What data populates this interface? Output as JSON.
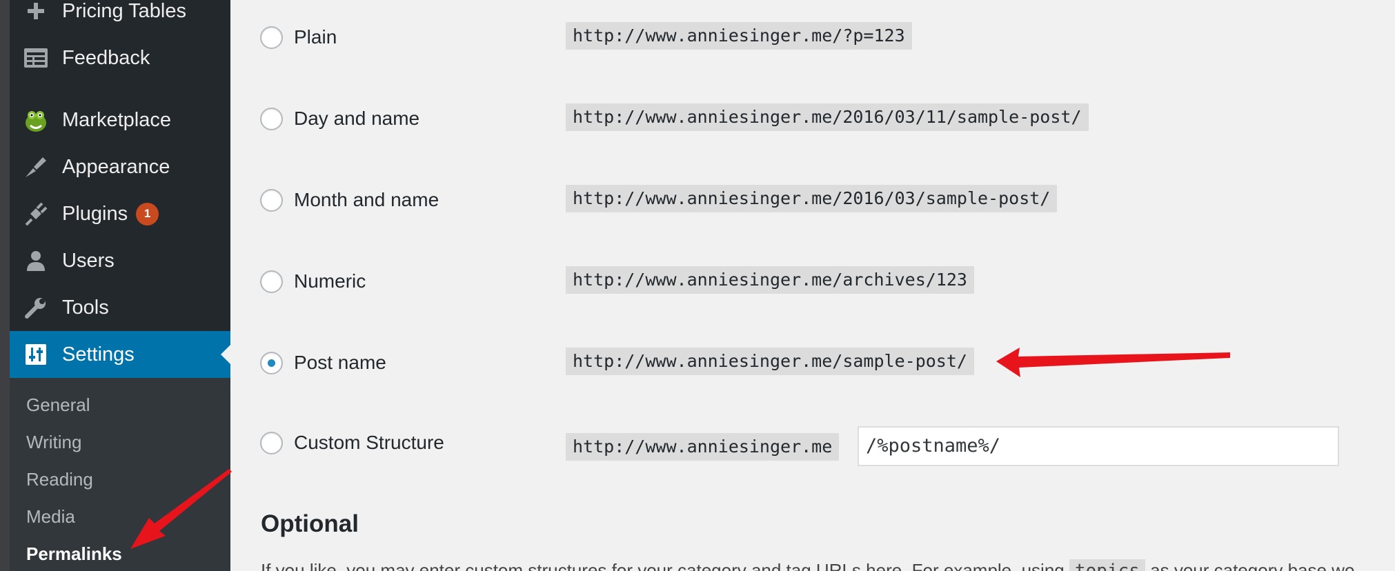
{
  "sidebar": {
    "menu": [
      {
        "label": "Pricing Tables",
        "icon": "plus-icon"
      },
      {
        "label": "Feedback",
        "icon": "feedback-icon"
      },
      {
        "label": "Marketplace",
        "icon": "marketplace-mascot-icon"
      },
      {
        "label": "Appearance",
        "icon": "paintbrush-icon"
      },
      {
        "label": "Plugins",
        "icon": "plug-icon",
        "badge": "1"
      },
      {
        "label": "Users",
        "icon": "user-icon"
      },
      {
        "label": "Tools",
        "icon": "wrench-icon"
      },
      {
        "label": "Settings",
        "icon": "settings-sliders-icon",
        "current": true
      }
    ],
    "submenu": [
      {
        "label": "General"
      },
      {
        "label": "Writing"
      },
      {
        "label": "Reading"
      },
      {
        "label": "Media"
      },
      {
        "label": "Permalinks",
        "current": true
      }
    ]
  },
  "permalinks": {
    "options": [
      {
        "label": "Plain",
        "example": "http://www.anniesinger.me/?p=123",
        "checked": false
      },
      {
        "label": "Day and name",
        "example": "http://www.anniesinger.me/2016/03/11/sample-post/",
        "checked": false
      },
      {
        "label": "Month and name",
        "example": "http://www.anniesinger.me/2016/03/sample-post/",
        "checked": false
      },
      {
        "label": "Numeric",
        "example": "http://www.anniesinger.me/archives/123",
        "checked": false
      },
      {
        "label": "Post name",
        "example": "http://www.anniesinger.me/sample-post/",
        "checked": true
      }
    ],
    "custom": {
      "label": "Custom Structure",
      "base": "http://www.anniesinger.me",
      "value": "/%postname%/",
      "checked": false
    }
  },
  "optional": {
    "title": "Optional",
    "desc_part1": "If you like, you may enter custom structures for your category and tag URLs here. For example, using",
    "desc_code": "topics",
    "desc_part2": "as your category base wo"
  },
  "colors": {
    "accent": "#0073aa",
    "badge": "#ca4a1f",
    "annotation_arrow": "#e8141b"
  }
}
